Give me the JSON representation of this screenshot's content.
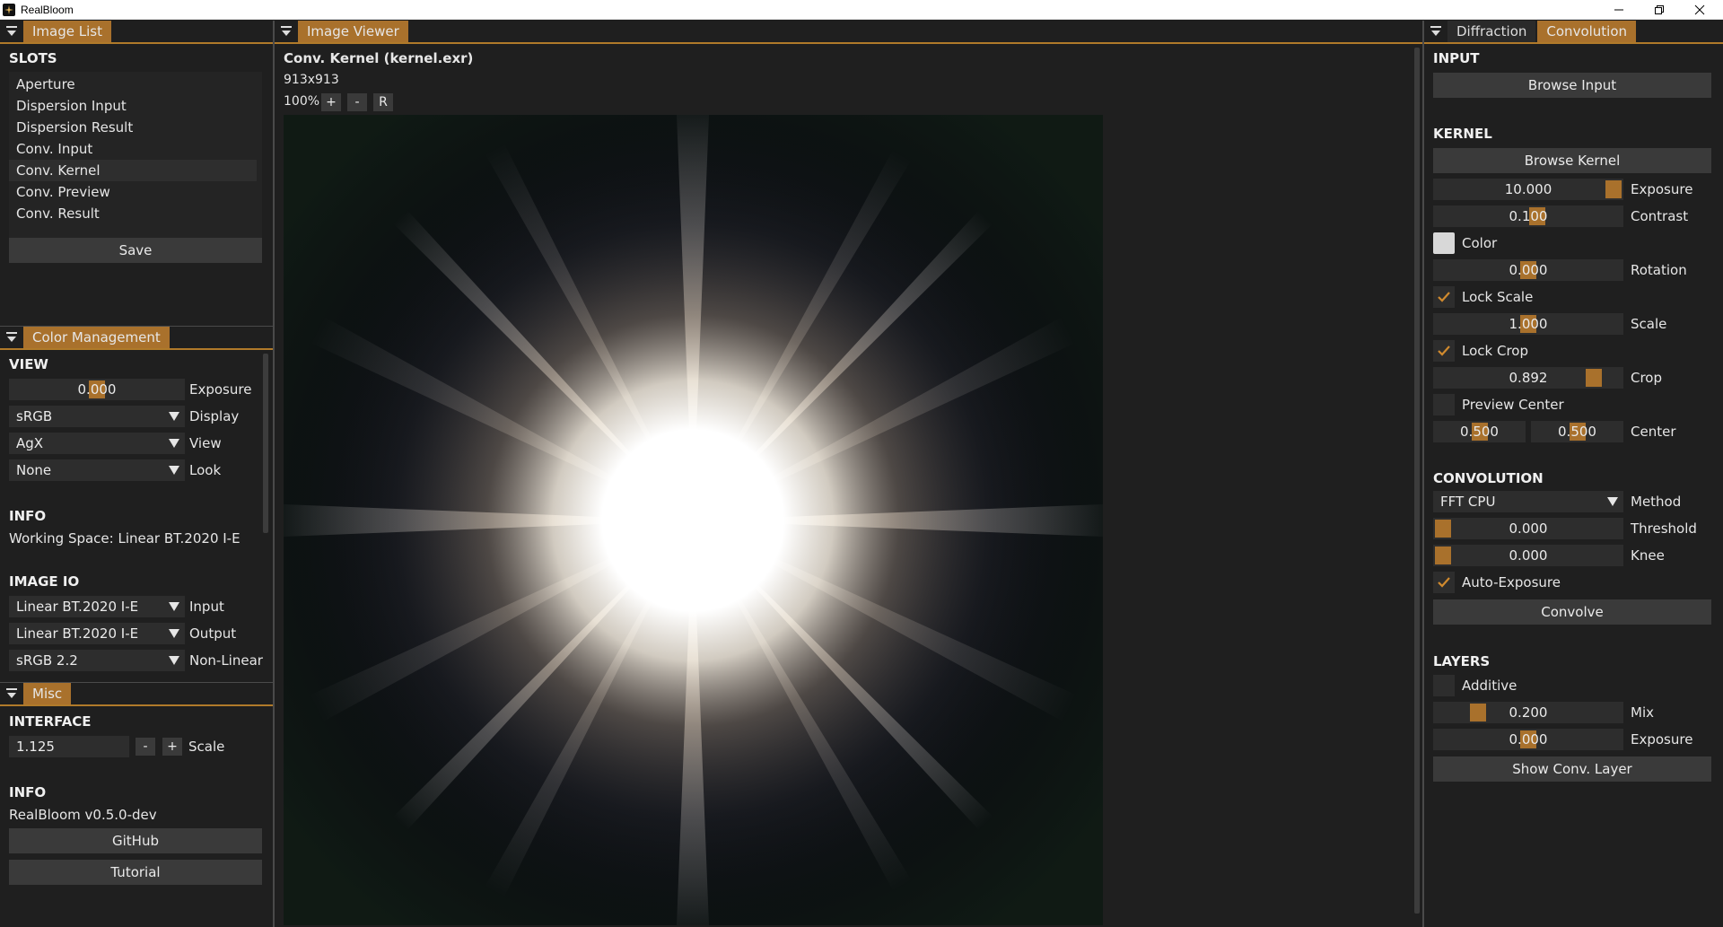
{
  "app": {
    "title": "RealBloom"
  },
  "left_top": {
    "tab": "Image List",
    "slots_title": "SLOTS",
    "slots": [
      "Aperture",
      "Dispersion Input",
      "Dispersion Result",
      "Conv. Input",
      "Conv. Kernel",
      "Conv. Preview",
      "Conv. Result"
    ],
    "selected_slot": "Conv. Kernel",
    "save_label": "Save"
  },
  "color_management": {
    "tab": "Color Management",
    "view_title": "VIEW",
    "exposure_value": "0.000",
    "exposure_label": "Exposure",
    "display_value": "sRGB",
    "display_label": "Display",
    "view_value": "AgX",
    "view_label": "View",
    "look_value": "None",
    "look_label": "Look",
    "info_title": "INFO",
    "working_space": "Working Space: Linear BT.2020 I-E",
    "imageio_title": "IMAGE IO",
    "input_value": "Linear BT.2020 I-E",
    "input_label": "Input",
    "output_value": "Linear BT.2020 I-E",
    "output_label": "Output",
    "nonlinear_value": "sRGB 2.2",
    "nonlinear_label": "Non-Linear"
  },
  "misc": {
    "tab": "Misc",
    "interface_title": "INTERFACE",
    "scale_value": "1.125",
    "minus": "-",
    "plus": "+",
    "scale_label": "Scale",
    "info_title": "INFO",
    "version": "RealBloom v0.5.0-dev",
    "github_label": "GitHub",
    "tutorial_label": "Tutorial"
  },
  "viewer": {
    "tab": "Image Viewer",
    "image_title": "Conv. Kernel (kernel.exr)",
    "dimensions": "913x913",
    "zoom": "100%",
    "zoom_in": "+",
    "zoom_out": "-",
    "reset": "R"
  },
  "right": {
    "tabs": [
      "Diffraction",
      "Convolution"
    ],
    "active_tab": "Convolution",
    "input_title": "INPUT",
    "browse_input": "Browse Input",
    "kernel_title": "KERNEL",
    "browse_kernel": "Browse Kernel",
    "k_exposure_value": "10.000",
    "k_exposure_label": "Exposure",
    "k_contrast_value": "0.100",
    "k_contrast_label": "Contrast",
    "k_color_label": "Color",
    "k_rotation_value": "0.000",
    "k_rotation_label": "Rotation",
    "lock_scale_label": "Lock Scale",
    "k_scale_value": "1.000",
    "k_scale_label": "Scale",
    "lock_crop_label": "Lock Crop",
    "k_crop_value": "0.892",
    "k_crop_label": "Crop",
    "preview_center_label": "Preview Center",
    "center_x": "0.500",
    "center_y": "0.500",
    "center_label": "Center",
    "convolution_title": "CONVOLUTION",
    "method_value": "FFT CPU",
    "method_label": "Method",
    "threshold_value": "0.000",
    "threshold_label": "Threshold",
    "knee_value": "0.000",
    "knee_label": "Knee",
    "auto_exposure_label": "Auto-Exposure",
    "convolve_label": "Convolve",
    "layers_title": "LAYERS",
    "additive_label": "Additive",
    "mix_value": "0.200",
    "mix_label": "Mix",
    "l_exposure_value": "0.000",
    "l_exposure_label": "Exposure",
    "show_layer_label": "Show Conv. Layer"
  },
  "colors": {
    "accent": "#a9712c",
    "panel_bg": "#1f1f1f",
    "field_bg": "#2d2d2d",
    "button_bg": "#3a3a3a"
  },
  "controls_state": {
    "lock_scale": true,
    "lock_crop": true,
    "preview_center": false,
    "auto_exposure": true,
    "additive": false
  }
}
